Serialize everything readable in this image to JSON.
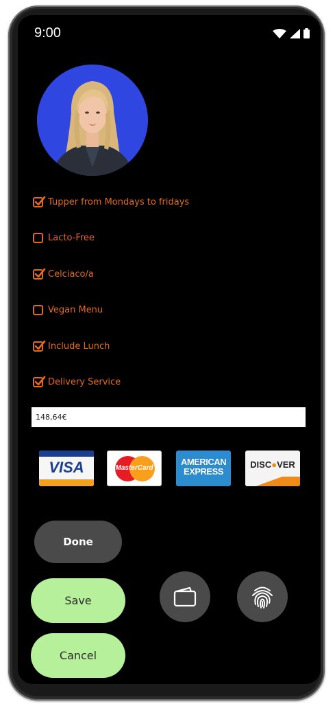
{
  "status_bar": {
    "time": "9:00",
    "icons": [
      "wifi-icon",
      "signal-icon",
      "battery-icon"
    ]
  },
  "profile": {
    "avatar": "avatar-photo",
    "avatar_bg_color": "#2f46e0"
  },
  "options": [
    {
      "label": "Tupper from Mondays to fridays",
      "checked": true
    },
    {
      "label": "Lacto-Free",
      "checked": false
    },
    {
      "label": "Celciaco/a",
      "checked": true
    },
    {
      "label": "Vegan Menu",
      "checked": false
    },
    {
      "label": "Include Lunch",
      "checked": true
    },
    {
      "label": "Delivery Service",
      "checked": true
    }
  ],
  "price": {
    "value": "148,64€"
  },
  "payment_cards": {
    "visa": "VISA",
    "mastercard": "MasterCard",
    "amex_line1": "AMERICAN",
    "amex_line2": "EXPRESS",
    "discover_pre": "DISC",
    "discover_post": "VER"
  },
  "buttons": {
    "done": "Done",
    "save": "Save",
    "cancel": "Cancel",
    "wallet_icon": "wallet-icon",
    "fingerprint_icon": "fingerprint-icon"
  },
  "colors": {
    "accent": "#e36a1a",
    "button_green": "#b6f09a",
    "button_dark": "#4a4a4a",
    "screen_bg": "#000000"
  }
}
